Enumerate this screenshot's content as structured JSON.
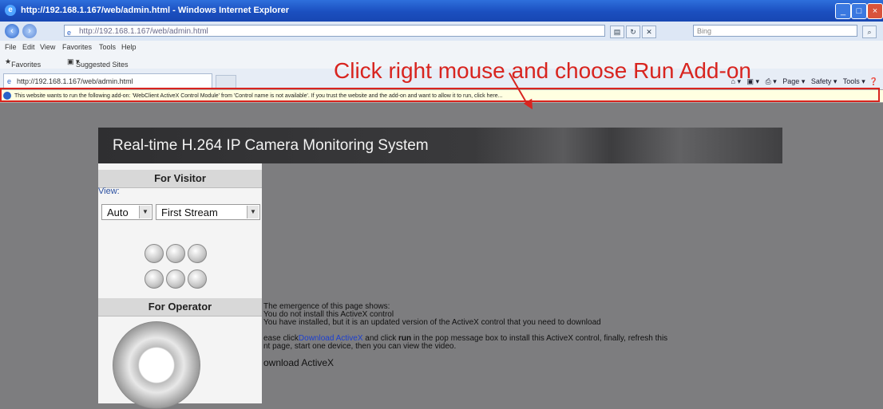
{
  "browser": {
    "title": "http://192.168.1.167/web/admin.html - Windows Internet Explorer",
    "address": "http://192.168.1.167/web/admin.html",
    "search_placeholder": "Bing",
    "menu": [
      "File",
      "Edit",
      "View",
      "Favorites",
      "Tools",
      "Help"
    ],
    "favorites_label": "Favorites",
    "suggested_sites": "Suggested Sites",
    "tab_label": "http://192.168.1.167/web/admin.html",
    "command_bar": [
      "Page",
      "Safety",
      "Tools"
    ],
    "infobar_message": "This website wants to run the following add-on: 'WebClient ActiveX Control Module' from 'Control name is not available'. If you trust the website and the add-on and want to allow it to run, click here..."
  },
  "annotation": {
    "text": "Click right mouse and choose Run Add-on",
    "color": "#d8241f"
  },
  "page": {
    "banner_title": "Real-time H.264 IP Camera Monitoring System",
    "visitor_panel_title": "For Visitor",
    "view_label": "View:",
    "view_mode": "Auto",
    "stream": "First Stream",
    "operator_panel_title": "For Operator",
    "message_lines": [
      "The emergence of this page shows:",
      "You do not install this ActiveX control",
      "You have installed, but it is an updated version of the ActiveX control that you need to download",
      "ease click",
      "and click",
      "run",
      "in the pop message box to install this ActiveX control, finally, refresh this",
      "nt page, start one device, then you can view the video.",
      "ownload ActiveX"
    ],
    "download_link": "Download ActiveX"
  },
  "icons": {
    "browser": "internet-explorer-icon",
    "back": "back-arrow-icon",
    "forward": "forward-arrow-icon",
    "camera_controls": [
      "preset-icon",
      "rotate-left-icon",
      "rotate-right-icon",
      "mirror-icon",
      "flip-icon",
      "reset-icon"
    ],
    "joystick": "ptz-joystick-icon"
  }
}
